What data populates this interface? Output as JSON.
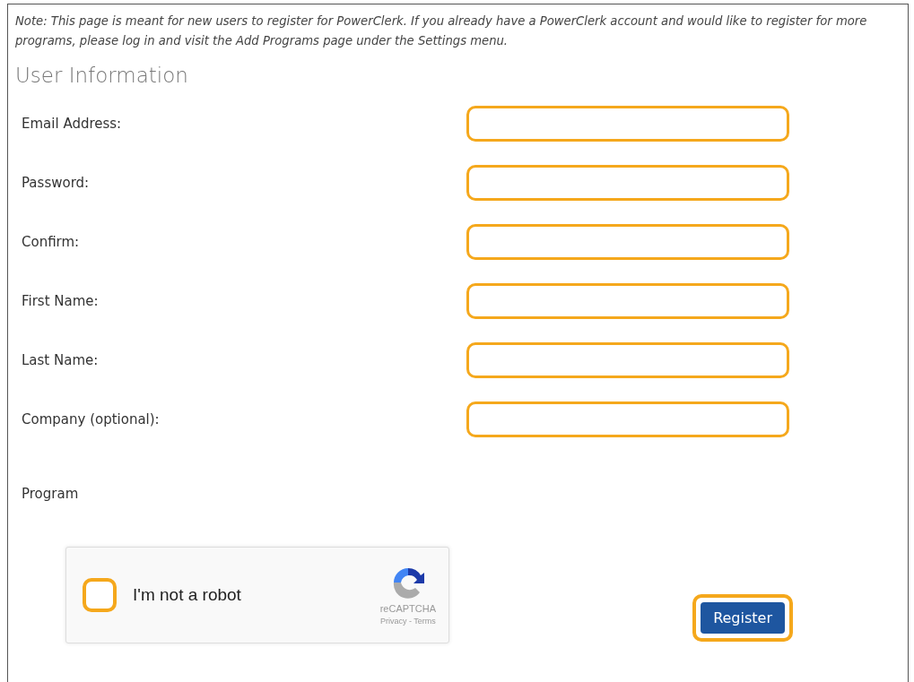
{
  "note": "Note: This page is meant for new users to register for PowerClerk. If you already have a PowerClerk account and would like to register for more programs, please log in and visit the Add Programs page under the Settings menu.",
  "section_title": "User Information",
  "fields": [
    {
      "label": "Email Address:"
    },
    {
      "label": "Password:"
    },
    {
      "label": "Confirm:"
    },
    {
      "label": "First Name:"
    },
    {
      "label": "Last Name:"
    },
    {
      "label": "Company (optional):"
    }
  ],
  "program_label": "Program",
  "captcha": {
    "label": "I'm not a robot",
    "checked": false,
    "brand": "reCAPTCHA",
    "links": "Privacy - Terms"
  },
  "register_button": "Register"
}
